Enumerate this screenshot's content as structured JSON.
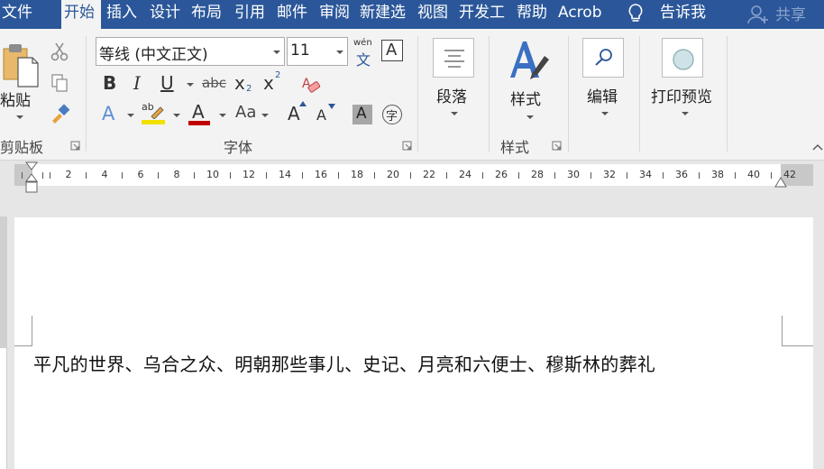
{
  "tabs": [
    {
      "label": "文件",
      "active": false
    },
    {
      "label": "开始",
      "active": true
    },
    {
      "label": "插入",
      "active": false
    },
    {
      "label": "设计",
      "active": false
    },
    {
      "label": "布局",
      "active": false
    },
    {
      "label": "引用",
      "active": false
    },
    {
      "label": "邮件",
      "active": false
    },
    {
      "label": "审阅",
      "active": false
    },
    {
      "label": "新建选",
      "active": false
    },
    {
      "label": "视图",
      "active": false
    },
    {
      "label": "开发工",
      "active": false
    },
    {
      "label": "帮助",
      "active": false
    },
    {
      "label": "Acrob",
      "active": false
    }
  ],
  "tell_me": "告诉我",
  "share": "共享",
  "clipboard": {
    "paste_label": "粘贴",
    "group_label": "剪贴板"
  },
  "font": {
    "font_name": "等线 (中文正文)",
    "font_size": "11",
    "pinyin_top": "wén",
    "pinyin_char": "文",
    "border_char": "A",
    "bold": "B",
    "italic": "I",
    "underline": "U",
    "strike": "abc",
    "sub_x": "x",
    "sub_2": "2",
    "sup_x": "x",
    "sup_2": "2",
    "effect_a": "A",
    "highlight_ab": "ab",
    "color_a": "A",
    "case_aa": "Aa",
    "grow_a": "A",
    "shrink_a": "A",
    "shade_a": "A",
    "enclose_char": "字",
    "group_label": "字体"
  },
  "paragraph": {
    "label": "段落"
  },
  "styles": {
    "label": "样式",
    "group_label": "样式"
  },
  "editing": {
    "label": "编辑"
  },
  "print_preview": {
    "label": "打印预览"
  },
  "ruler": {
    "numbers": [
      "2",
      "4",
      "6",
      "8",
      "10",
      "12",
      "14",
      "16",
      "18",
      "20",
      "22",
      "24",
      "26",
      "28",
      "30",
      "32",
      "34",
      "36",
      "38",
      "40",
      "42"
    ]
  },
  "document": {
    "text": "平凡的世界、乌合之众、明朝那些事儿、史记、月亮和六便士、穆斯林的葬礼"
  }
}
